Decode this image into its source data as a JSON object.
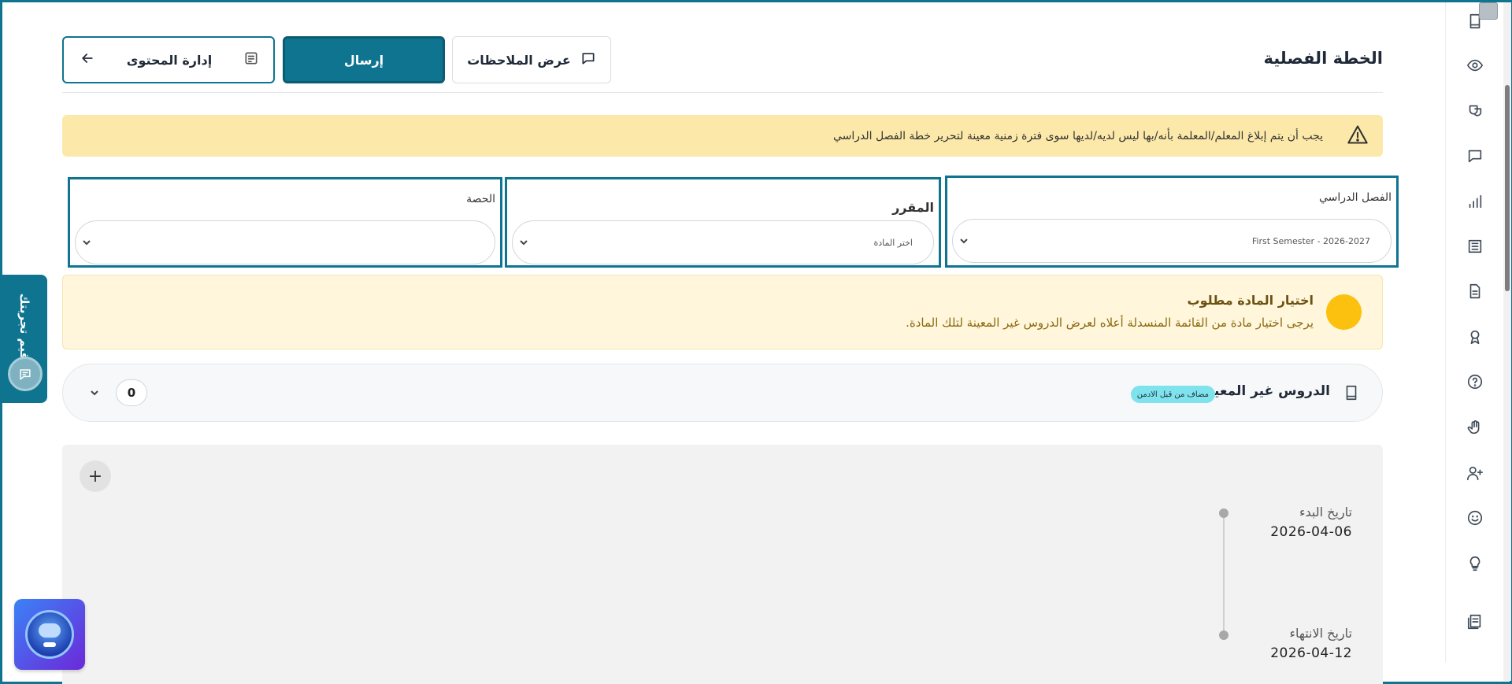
{
  "header": {
    "title": "الخطة الفصلية",
    "buttons": {
      "content_management": "إدارة المحتوى",
      "send": "إرسال",
      "view_notes": "عرض الملاحظات"
    }
  },
  "warning_banner": {
    "text": "يجب أن يتم إبلاغ المعلم/المعلمة بأنه/بها ليس لديه/لديها سوى فترة زمنية معينة لتحرير خطة الفصل الدراسي"
  },
  "filters": {
    "semester": {
      "label": "الفصل الدراسي",
      "value": "First Semester - 2026-2027"
    },
    "course": {
      "label": "المقرر",
      "placeholder": "اختر المادة"
    },
    "period": {
      "label": "الحصة",
      "value": ""
    }
  },
  "info_banner": {
    "title": "اختيار المادة مطلوب",
    "description": "يرجى اختيار مادة من القائمة المنسدلة أعلاه لعرض الدروس غير المعينة لتلك المادة."
  },
  "unassigned_lessons": {
    "title": "الدروس غير المعينة",
    "badge": "مضاف من قبل الادمن",
    "count": "0"
  },
  "timeline": {
    "add_symbol": "+",
    "start_label": "تاريخ البدء",
    "start_date": "2026-04-06",
    "end_label": "تاريخ الانتهاء",
    "end_date": "2026-04-12"
  },
  "feedback_tab": {
    "label": "قيم تجربتك"
  },
  "icons": {
    "rail": [
      "book-icon",
      "eye-icon",
      "masks-icon",
      "chat-icon",
      "bar-chart-icon",
      "list-icon",
      "document-icon",
      "award-icon",
      "help-icon",
      "hand-icon",
      "add-user-icon",
      "smile-icon",
      "lightbulb-icon",
      "notes-icon"
    ]
  },
  "colors": {
    "accent": "#0e7490",
    "warning_bg": "#fce9a9",
    "info_bg": "#fff6db",
    "info_dot": "#fcc10f",
    "badge_bg": "#7fe3ee"
  }
}
